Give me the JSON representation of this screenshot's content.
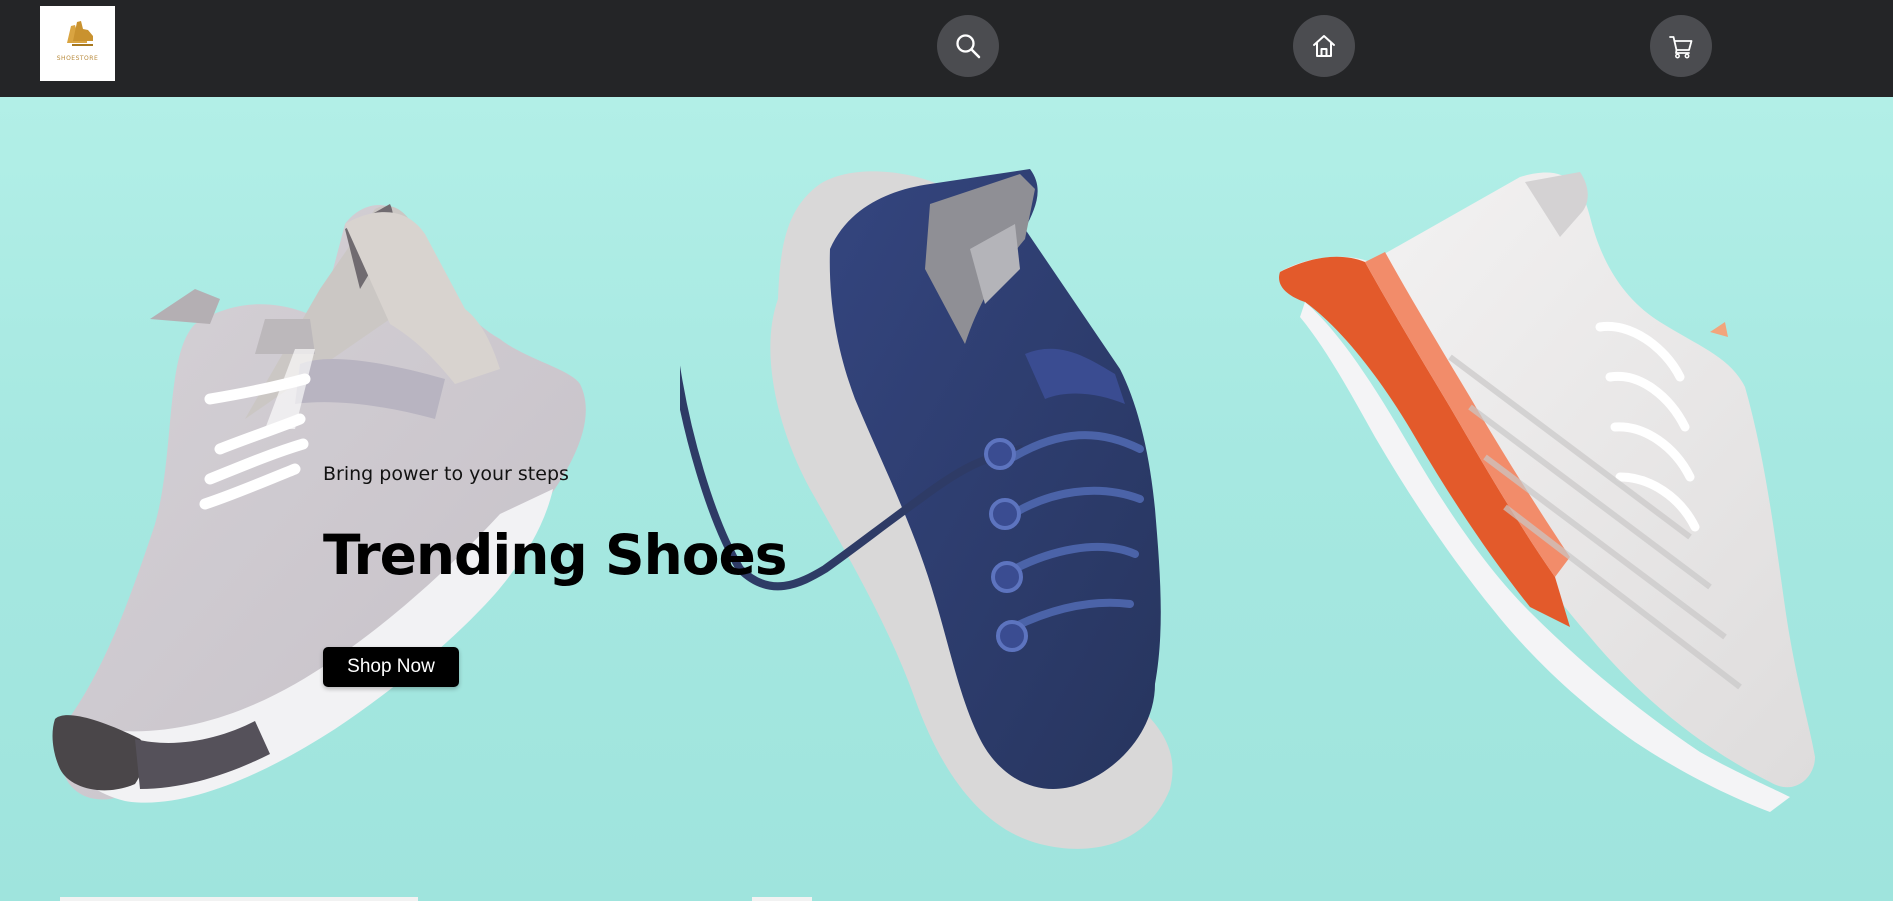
{
  "header": {
    "logo": {
      "text": "SHOESTORE",
      "icon": "shoe-logo-icon"
    },
    "nav": [
      {
        "name": "search",
        "icon": "search-icon"
      },
      {
        "name": "home",
        "icon": "home-icon"
      },
      {
        "name": "cart",
        "icon": "cart-icon"
      }
    ]
  },
  "hero": {
    "tagline": "Bring power to your steps",
    "headline": "Trending Shoes",
    "cta_label": "Shop Now",
    "colors": {
      "background": "#a9e9e2",
      "topbar": "#242527",
      "nav_circle": "#4b4c50",
      "cta": "#000000"
    },
    "products": [
      {
        "name": "grey-knit-sneaker"
      },
      {
        "name": "navy-knit-sneaker"
      },
      {
        "name": "white-orange-running-shoe"
      }
    ]
  }
}
